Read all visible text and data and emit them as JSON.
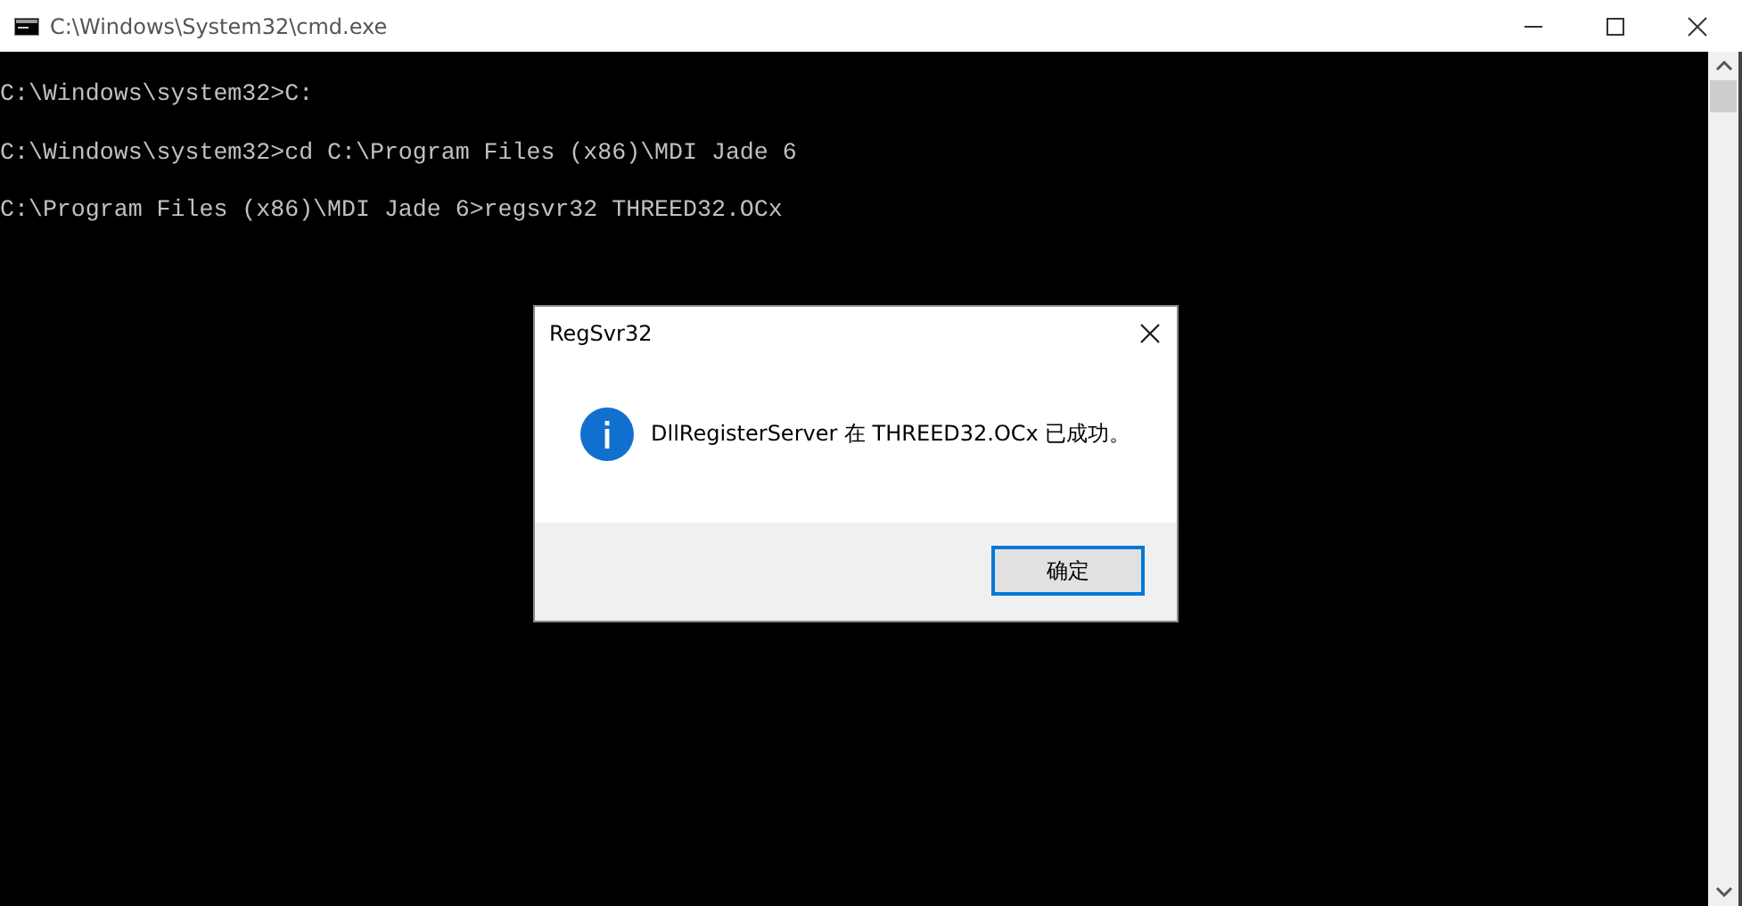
{
  "window": {
    "title": "C:\\Windows\\System32\\cmd.exe"
  },
  "console": {
    "lines": [
      "C:\\Windows\\system32>C:",
      "C:\\Windows\\system32>cd C:\\Program Files (x86)\\MDI Jade 6",
      "C:\\Program Files (x86)\\MDI Jade 6>regsvr32 THREED32.OCx"
    ]
  },
  "dialog": {
    "title": "RegSvr32",
    "message": "DllRegisterServer 在 THREED32.OCx 已成功。",
    "buttons": [
      {
        "label": "确定",
        "selected": true
      }
    ]
  }
}
